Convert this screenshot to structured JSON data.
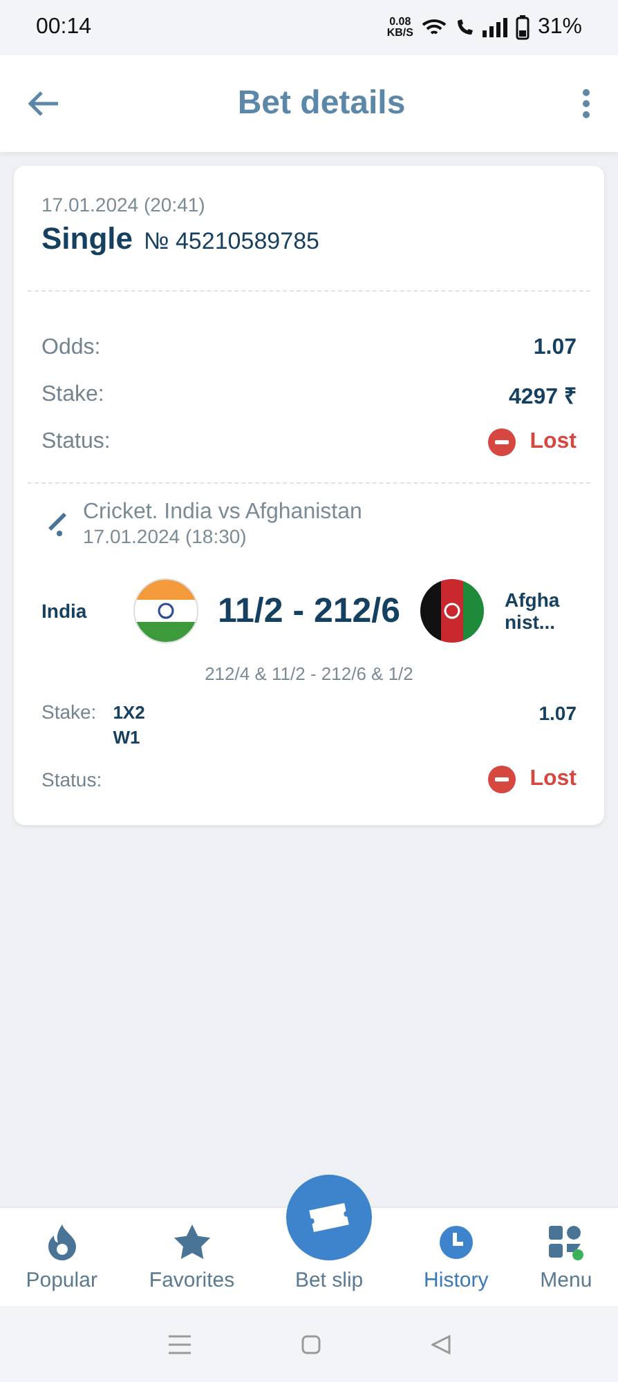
{
  "status_bar": {
    "time": "00:14",
    "speed": "0.08",
    "speed_unit": "KB/S",
    "battery": "31%"
  },
  "header": {
    "title": "Bet details"
  },
  "bet": {
    "date": "17.01.2024 (20:41)",
    "type": "Single",
    "number": "№ 45210589785",
    "rows": [
      {
        "label": "Odds:",
        "value": "1.07",
        "kind": "text"
      },
      {
        "label": "Stake:",
        "value": "4297 ₹",
        "kind": "text"
      },
      {
        "label": "Status:",
        "value": "Lost",
        "kind": "status",
        "lost": true
      }
    ]
  },
  "event": {
    "title": "Cricket. India vs Afghanistan",
    "date": "17.01.2024 (18:30)",
    "team_1": "India",
    "team_2": "Afgha nist...",
    "score": "11/2 - 212/6",
    "details": "212/4 & 11/2 - 212/6 & 1/2",
    "stake_label": "Stake:",
    "market": "1X2",
    "pick": "W1",
    "odds": "1.07",
    "status_label": "Status:",
    "status_text": "Lost",
    "lost": true
  },
  "nav": [
    {
      "label": "Popular",
      "kind": "popular",
      "selected": false
    },
    {
      "label": "Favorites",
      "kind": "favorites",
      "selected": false
    },
    {
      "label": "Bet slip",
      "kind": "betslip",
      "selected": false
    },
    {
      "label": "History",
      "kind": "history",
      "selected": true
    },
    {
      "label": "Menu",
      "kind": "menu",
      "selected": false
    }
  ]
}
